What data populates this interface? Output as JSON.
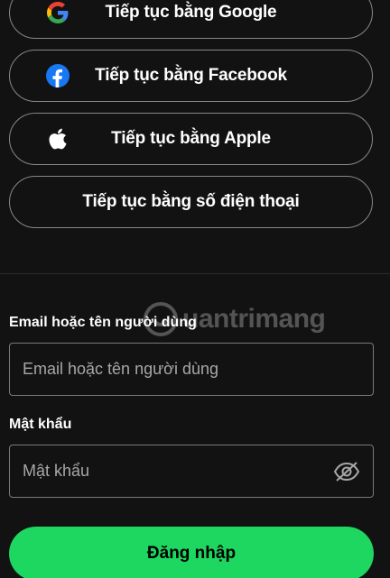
{
  "social_buttons": {
    "google": {
      "label": "Tiếp tục bằng Google",
      "icon": "google-icon"
    },
    "facebook": {
      "label": "Tiếp tục bằng Facebook",
      "icon": "facebook-icon"
    },
    "apple": {
      "label": "Tiếp tục bằng Apple",
      "icon": "apple-icon"
    },
    "phone": {
      "label": "Tiếp tục bằng số điện thoại"
    }
  },
  "login_form": {
    "email": {
      "label": "Email hoặc tên người dùng",
      "placeholder": "Email hoặc tên người dùng",
      "value": ""
    },
    "password": {
      "label": "Mật khẩu",
      "placeholder": "Mật khẩu",
      "value": "",
      "toggle_icon": "eye-off-icon"
    },
    "submit_label": "Đăng nhập"
  },
  "watermark": {
    "text": "uantrimang"
  },
  "colors": {
    "background": "#121212",
    "accent": "#1ed760",
    "border": "#878787",
    "placeholder": "#a7a7a7",
    "facebook_blue": "#1877f2"
  }
}
